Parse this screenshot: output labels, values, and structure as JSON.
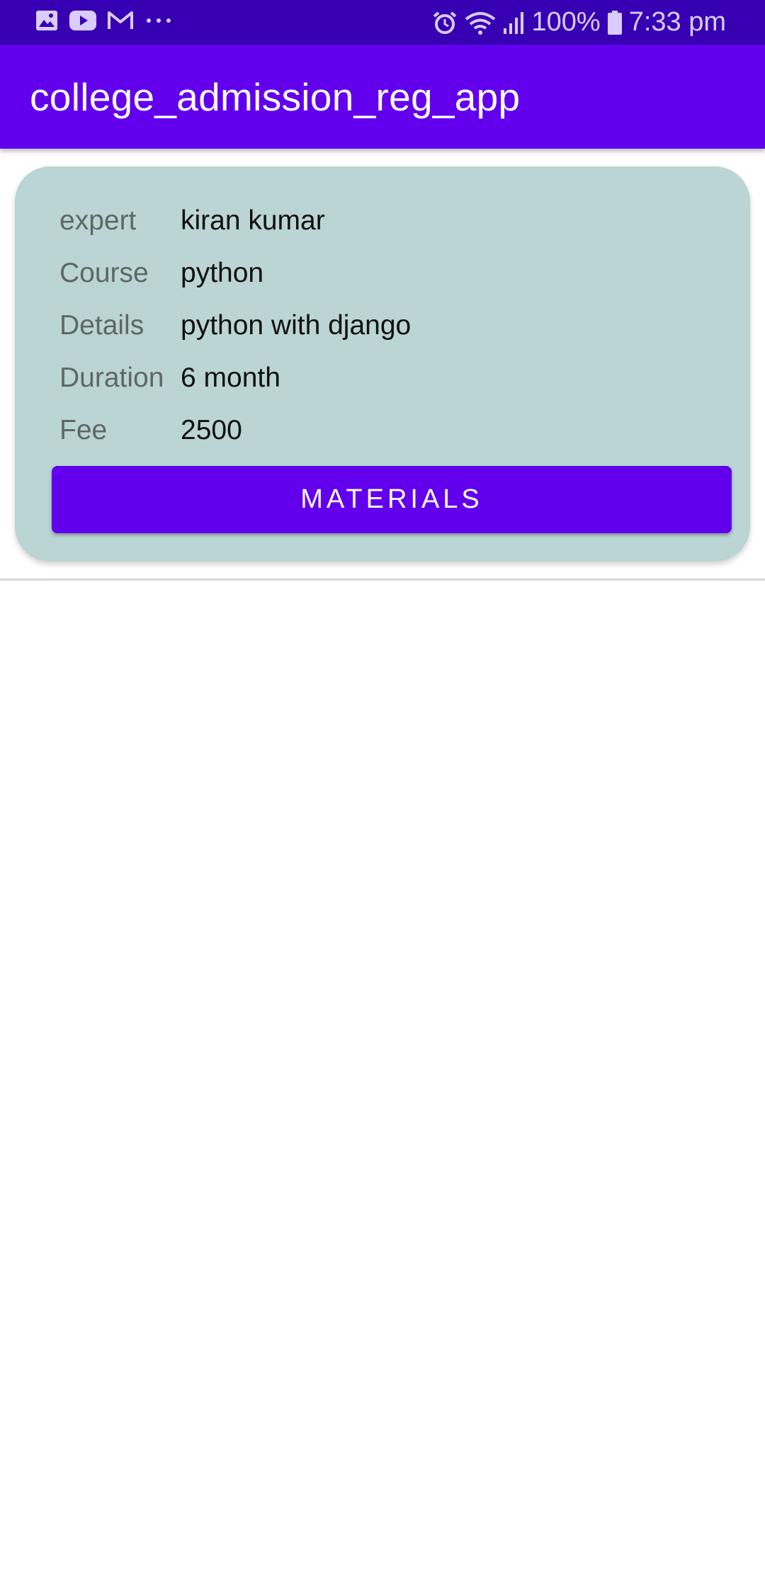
{
  "status_bar": {
    "battery": "100%",
    "time": "7:33 pm",
    "icons": [
      "gallery-icon",
      "youtube-icon",
      "gmail-icon",
      "more-dots-icon",
      "alarm-icon",
      "wifi-icon",
      "signal-icon",
      "battery-icon"
    ]
  },
  "app_bar": {
    "title": "college_admission_reg_app"
  },
  "card": {
    "rows": [
      {
        "label": "expert",
        "value": "kiran kumar"
      },
      {
        "label": "Course",
        "value": "python"
      },
      {
        "label": "Details",
        "value": "python with django"
      },
      {
        "label": "Duration",
        "value": "6 month"
      },
      {
        "label": "Fee",
        "value": "2500"
      }
    ],
    "button_label": "MATERIALS"
  },
  "colors": {
    "status_bar": "#3700b3",
    "app_bar": "#6200ee",
    "card_background": "#bad5d3",
    "button": "#6200ee"
  }
}
